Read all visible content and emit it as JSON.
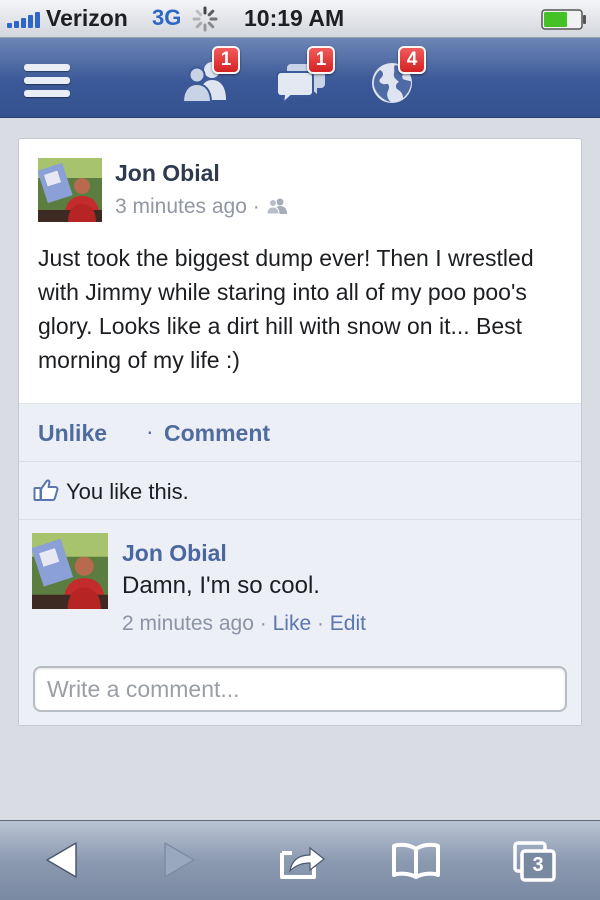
{
  "status_bar": {
    "carrier": "Verizon",
    "network": "3G",
    "time": "10:19 AM",
    "signal_bars": 5,
    "battery_level": 0.6,
    "battery_color": "#43c125"
  },
  "top_bar": {
    "background": "#3b5998",
    "menu_icon": "hamburger-menu-icon",
    "friend_requests": {
      "icon": "friend-requests-icon",
      "badge": "1"
    },
    "messages": {
      "icon": "messages-icon",
      "badge": "1"
    },
    "notifications": {
      "icon": "globe-notifications-icon",
      "badge": "4"
    }
  },
  "post": {
    "author": "Jon Obial",
    "timestamp": "3 minutes ago",
    "separator": "·",
    "audience_icon": "friends-icon",
    "text": "Just took the biggest dump ever! Then I wrestled with Jimmy while staring into all of my poo poo's glory. Looks like a dirt hill with snow on it... Best morning of my life :)",
    "actions": {
      "unlike": "Unlike",
      "dot": "·",
      "comment": "Comment"
    },
    "likes_text": "You like this."
  },
  "comment": {
    "author": "Jon Obial",
    "text": "Damn, I'm so cool.",
    "timestamp": "2 minutes ago",
    "sep1": " · ",
    "like": "Like",
    "sep2": " · ",
    "edit": "Edit"
  },
  "comment_box": {
    "placeholder": "Write a comment..."
  },
  "toolbar": {
    "back_icon": "back-arrow-icon",
    "forward_icon": "forward-arrow-icon",
    "share_icon": "share-icon",
    "bookmarks_icon": "bookmarks-icon",
    "tabs_icon": "tabs-icon",
    "tabs_count": "3"
  }
}
